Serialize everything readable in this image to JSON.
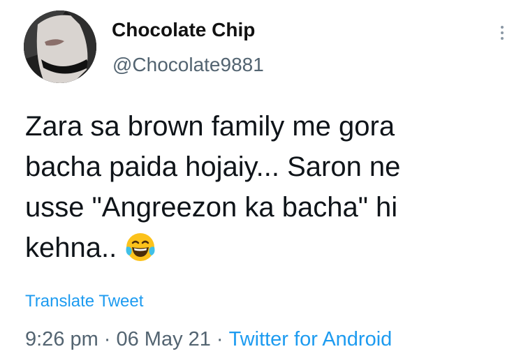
{
  "author": {
    "display_name": "Chocolate Chip",
    "handle": "@Chocolate9881"
  },
  "tweet": {
    "lines": [
      "Zara sa brown family me gora",
      "bacha paida hojaiy... Saron ne",
      "usse \"Angreezon ka bacha\" hi",
      "kehna.."
    ],
    "emoji": "face-with-tears-of-joy"
  },
  "translate_label": "Translate Tweet",
  "meta": {
    "time": "9:26 pm",
    "separator": "·",
    "date": "06 May 21",
    "source": "Twitter for Android"
  },
  "colors": {
    "link": "#1d9bf0",
    "secondary_text": "#536471",
    "primary_text": "#0f1419"
  },
  "icons": {
    "more": "more-vertical-icon"
  }
}
